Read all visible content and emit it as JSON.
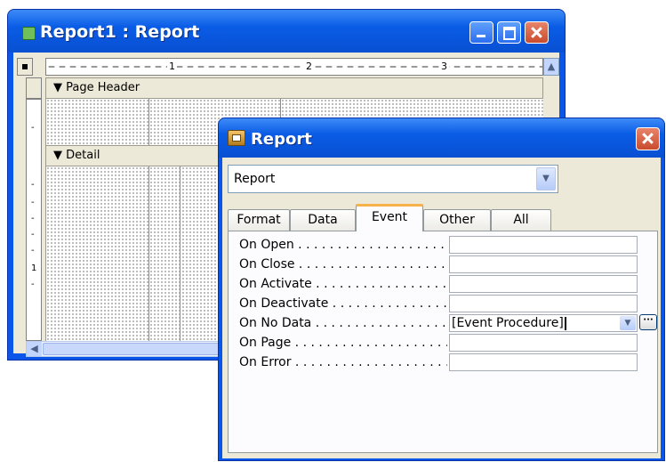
{
  "report_window": {
    "title": "Report1 : Report",
    "ruler_marks": [
      "1",
      "2",
      "3"
    ],
    "vruler_marks": [
      "-",
      "-",
      "-",
      "-",
      "-",
      "-",
      "1",
      "-"
    ],
    "sections": {
      "page_header": "Page Header",
      "detail": "Detail"
    }
  },
  "property_sheet": {
    "title": "Report",
    "object_selector": "Report",
    "tabs": [
      "Format",
      "Data",
      "Event",
      "Other",
      "All"
    ],
    "active_tab": "Event",
    "properties": [
      {
        "label": "On Open . . . . . . . . . . . . . . . . . . . . . . . . . . . .",
        "value": ""
      },
      {
        "label": "On Close . . . . . . . . . . . . . . . . . . . . . . . . . . . .",
        "value": ""
      },
      {
        "label": "On Activate . . . . . . . . . . . . . . . . . . . . . . . . . .",
        "value": ""
      },
      {
        "label": "On Deactivate . . . . . . . . . . . . . . . . . . . . . . . . .",
        "value": ""
      },
      {
        "label": "On No Data . . . . . . . . . . . . . . . . . . . . . . . . . . .",
        "value": "[Event Procedure]"
      },
      {
        "label": "On Page . . . . . . . . . . . . . . . . . . . . . . . . . . . .",
        "value": ""
      },
      {
        "label": "On Error . . . . . . . . . . . . . . . . . . . . . . . . . . . .",
        "value": ""
      }
    ]
  }
}
